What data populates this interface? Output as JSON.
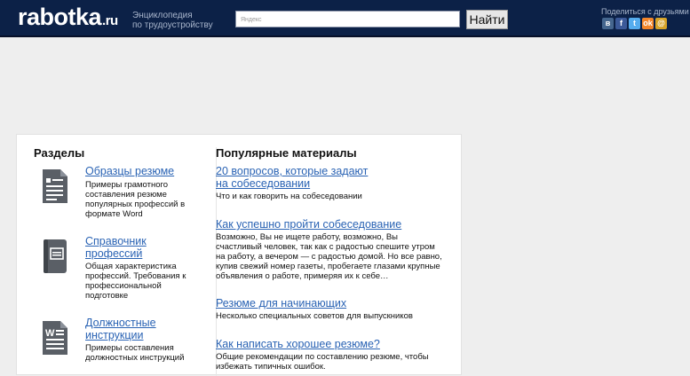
{
  "header": {
    "logo_main": "rabotka",
    "logo_tld": ".ru",
    "tagline_line1": "Энциклопедия",
    "tagline_line2": "по трудоустройству",
    "search_placeholder": "Яндекс",
    "search_button": "Найти",
    "share_label": "Поделиться с друзьями",
    "share_icons": [
      "vk-icon",
      "facebook-icon",
      "twitter-icon",
      "odnoklassniki-icon",
      "mailru-icon"
    ]
  },
  "sections": {
    "title": "Разделы",
    "items": [
      {
        "icon": "document-icon",
        "link": "Образцы резюме",
        "desc": "Примеры грамотного составления резюме популярных профессий в формате Word"
      },
      {
        "icon": "notebook-icon",
        "link": "Справочник профессий",
        "desc": "Общая характеристика профессий. Требования к профессиональной подготовке"
      },
      {
        "icon": "word-document-icon",
        "link": "Должностные инструкции",
        "desc": "Примеры составления должностных инструкций"
      }
    ]
  },
  "popular": {
    "title": "Популярные материалы",
    "items": [
      {
        "link": "20 вопросов, которые задают на собеседовании",
        "desc": "Что и как говорить на собеседовании"
      },
      {
        "link": "Как успешно пройти собеседование",
        "desc": "Возможно, Вы не ищете работу, возможно, Вы счастливый человек, так как с радостью спешите утром на работу, а вечером — с радостью домой. Но все равно, купив свежий номер газеты, пробегаете глазами крупные объявления о работе, примеряя их к себе…"
      },
      {
        "link": "Резюме для начинающих",
        "desc": "Несколько специальных советов для выпускников"
      },
      {
        "link": "Как написать хорошее резюме?",
        "desc": "Общие рекомендации по составлению резюме, чтобы избежать типичных ошибок."
      }
    ]
  },
  "colors": {
    "header_bg": "#0c2147",
    "link": "#2a63b4",
    "page_bg": "#eeeeee"
  }
}
